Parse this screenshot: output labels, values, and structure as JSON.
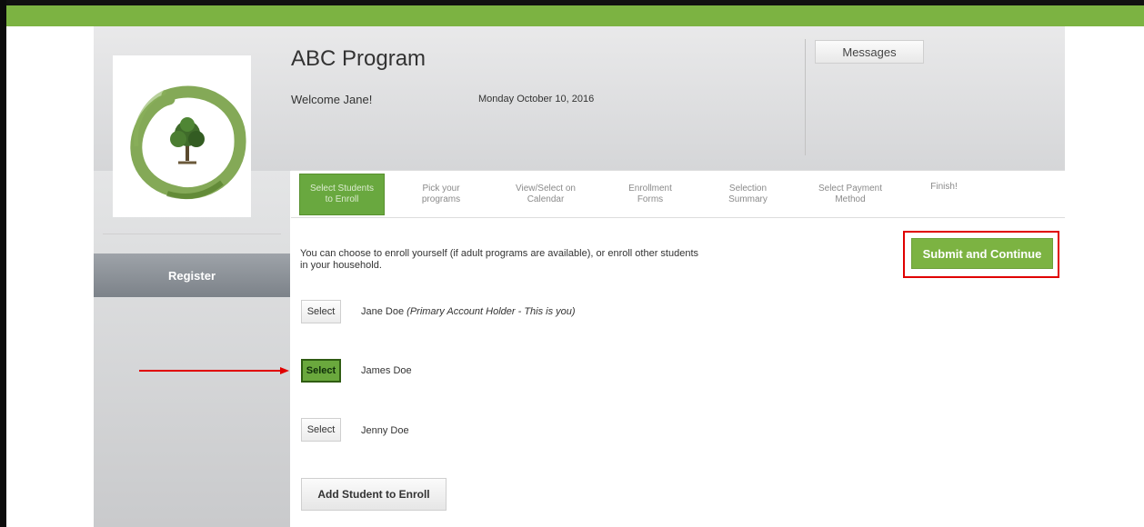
{
  "header": {
    "program_title": "ABC Program",
    "welcome": "Welcome Jane!",
    "date": "Monday October 10, 2016",
    "messages_label": "Messages"
  },
  "sidebar": {
    "register_label": "Register"
  },
  "steps": [
    {
      "line1": "Select Students",
      "line2": "to Enroll",
      "active": true
    },
    {
      "line1": "Pick your",
      "line2": "programs",
      "active": false
    },
    {
      "line1": "View/Select on",
      "line2": "Calendar",
      "active": false
    },
    {
      "line1": "Enrollment",
      "line2": "Forms",
      "active": false
    },
    {
      "line1": "Selection",
      "line2": "Summary",
      "active": false
    },
    {
      "line1": "Select Payment",
      "line2": "Method",
      "active": false
    },
    {
      "line1": "Finish!",
      "line2": "",
      "active": false
    }
  ],
  "content": {
    "intro": "You can choose to enroll yourself (if adult programs are available), or enroll other students in your household.",
    "submit_label": "Submit and Continue",
    "students": [
      {
        "select_label": "Select",
        "name": "Jane Doe",
        "note": "(Primary Account Holder - This is you)",
        "selected": false
      },
      {
        "select_label": "Select",
        "name": "James Doe",
        "note": "",
        "selected": true
      },
      {
        "select_label": "Select",
        "name": "Jenny Doe",
        "note": "",
        "selected": false
      }
    ],
    "add_student_label": "Add Student to Enroll"
  },
  "colors": {
    "brand_green": "#7cb342",
    "highlight_red": "#e00000"
  }
}
